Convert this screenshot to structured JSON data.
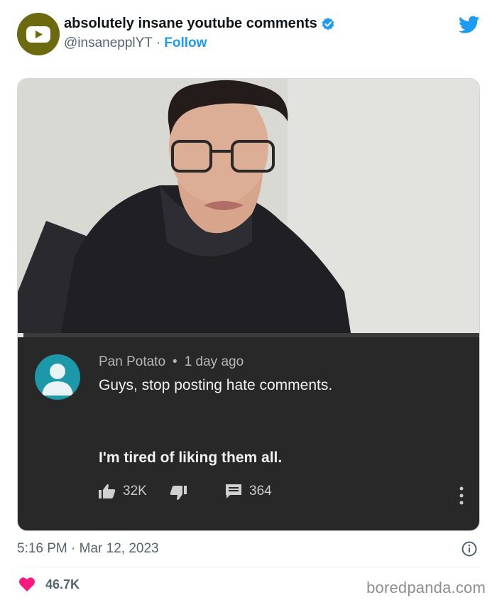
{
  "tweet": {
    "account_name": "absolutely insane youtube comments",
    "handle": "@insanepplYT",
    "separator": "·",
    "follow_label": "Follow",
    "timestamp": "5:16 PM · Mar 12, 2023",
    "likes_count": "46.7K",
    "colors": {
      "accent": "#1d9bf0",
      "heart": "#f91880",
      "avatar_bg": "#6b6a0e"
    }
  },
  "comment": {
    "author": "Pan Potato",
    "bullet": "•",
    "time_ago": "1 day ago",
    "line1": "Guys, stop posting hate comments.",
    "line2": "I'm tired of liking them all.",
    "like_count": "32K",
    "reply_count": "364",
    "colors": {
      "background": "#282828",
      "avatar": "#1c98a9"
    }
  },
  "watermark": "boredpanda.com",
  "icons": [
    "youtube-icon",
    "verified-icon",
    "twitter-bird-icon",
    "thumbs-up-icon",
    "thumbs-down-icon",
    "reply-icon",
    "more-vertical-icon",
    "info-icon",
    "heart-icon"
  ]
}
